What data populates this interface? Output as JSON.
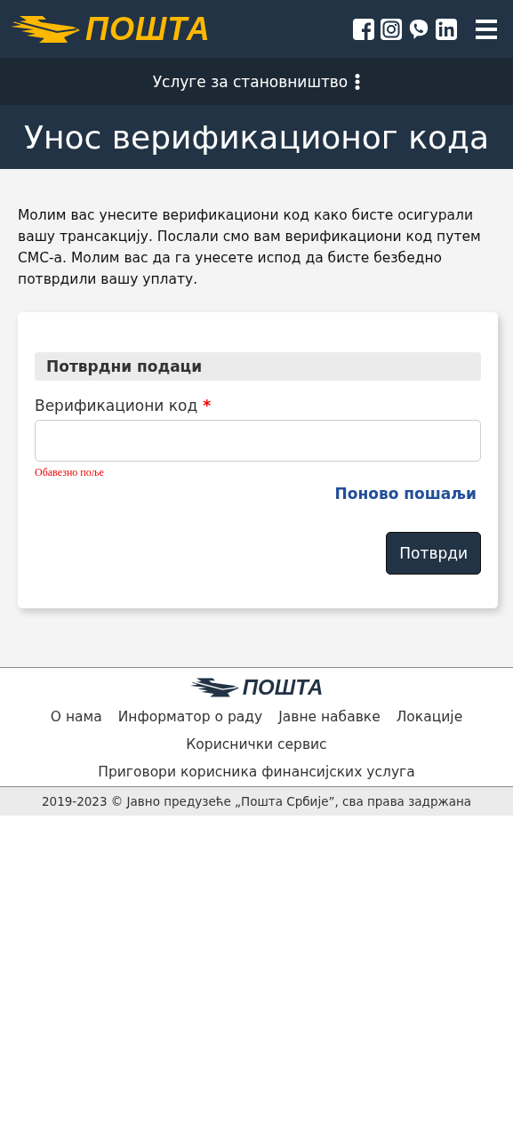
{
  "header": {
    "logo_text": "ПОШТА",
    "social": [
      {
        "kind": "facebook"
      },
      {
        "kind": "instagram"
      },
      {
        "kind": "viber"
      },
      {
        "kind": "linkedin"
      }
    ]
  },
  "subnav": {
    "label": "Услуге за становништво"
  },
  "page_title": "Унос верификационог кода",
  "intro": "Молим вас унесите верификациони код како бисте осигурали вашу трансакцију. Послали смо вам верификациони код путем СМС-а. Молим вас да га унесете испод да бисте безбедно потврдили вашу уплату.",
  "form": {
    "section_title": "Потврдни подаци",
    "field": {
      "label": "Верификациони код",
      "required": true,
      "required_mark": "*",
      "error": "Обавезно поље"
    },
    "resend_link": "Поново пошаљи",
    "submit_button": "Потврди"
  },
  "footer": {
    "logo_text": "ПОШТА",
    "links": [
      {
        "label": "О нама"
      },
      {
        "label": "Информатор о раду"
      },
      {
        "label": "Јавне набавке"
      },
      {
        "label": "Локације"
      },
      {
        "label": "Кориснички сервис"
      },
      {
        "label": "Приговори корисника финансијских услуга"
      }
    ],
    "copyright": "2019-2023 © Јавно предузеће „Пошта Србије”, сва права задржана"
  }
}
